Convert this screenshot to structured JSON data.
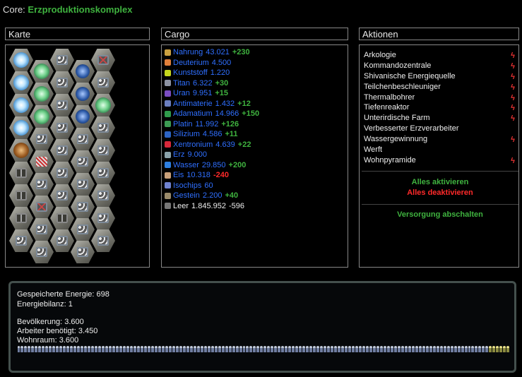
{
  "core": {
    "prefix": "Core:",
    "name": "Erzproduktionskomplex"
  },
  "panels": {
    "map": "Karte",
    "cargo": "Cargo",
    "actions": "Aktionen"
  },
  "cargo": [
    {
      "name": "Nahrung",
      "amount": "43.021",
      "delta": "+230",
      "sign": "pos",
      "color": "#caa040"
    },
    {
      "name": "Deuterium",
      "amount": "4.500",
      "delta": "",
      "sign": "",
      "color": "#e07f3a"
    },
    {
      "name": "Kunststoff",
      "amount": "1.220",
      "delta": "",
      "sign": "",
      "color": "#c6d81d"
    },
    {
      "name": "Titan",
      "amount": "6.322",
      "delta": "+30",
      "sign": "pos",
      "color": "#8d93a3"
    },
    {
      "name": "Uran",
      "amount": "9.951",
      "delta": "+15",
      "sign": "pos",
      "color": "#7a4cc2"
    },
    {
      "name": "Antimaterie",
      "amount": "1.432",
      "delta": "+12",
      "sign": "pos",
      "color": "#6b7fc0"
    },
    {
      "name": "Adamatium",
      "amount": "14.966",
      "delta": "+150",
      "sign": "pos",
      "color": "#2f9b4b"
    },
    {
      "name": "Platin",
      "amount": "11.992",
      "delta": "+126",
      "sign": "pos",
      "color": "#3c9b53"
    },
    {
      "name": "Silizium",
      "amount": "4.586",
      "delta": "+11",
      "sign": "pos",
      "color": "#2c64c4"
    },
    {
      "name": "Xentronium",
      "amount": "4.639",
      "delta": "+22",
      "sign": "pos",
      "color": "#d8283a"
    },
    {
      "name": "Erz",
      "amount": "9.000",
      "delta": "",
      "sign": "",
      "color": "#8aa2aa"
    },
    {
      "name": "Wasser",
      "amount": "29.850",
      "delta": "+200",
      "sign": "pos",
      "color": "#2e7fe0"
    },
    {
      "name": "Eis",
      "amount": "10.318",
      "delta": "-240",
      "sign": "neg",
      "color": "#c9a07a"
    },
    {
      "name": "Isochips",
      "amount": "60",
      "delta": "",
      "sign": "",
      "color": "#6f82d0"
    },
    {
      "name": "Gestein",
      "amount": "2.200",
      "delta": "+40",
      "sign": "pos",
      "color": "#9a8a6a"
    }
  ],
  "cargo_total": {
    "label": "Leer",
    "amount": "1.845.952",
    "delta": "-596"
  },
  "actions": [
    {
      "label": "Arkologie",
      "bolt": true
    },
    {
      "label": "Kommandozentrale",
      "bolt": true
    },
    {
      "label": "Shivanische Energiequelle",
      "bolt": true
    },
    {
      "label": "Teilchenbeschleuniger",
      "bolt": true
    },
    {
      "label": "Thermalbohrer",
      "bolt": true
    },
    {
      "label": "Tiefenreaktor",
      "bolt": true
    },
    {
      "label": "Unterirdische Farm",
      "bolt": true
    },
    {
      "label": "Verbesserter Erzverarbeiter",
      "bolt": false
    },
    {
      "label": "Wassergewinnung",
      "bolt": true
    },
    {
      "label": "Werft",
      "bolt": false
    },
    {
      "label": "Wohnpyramide",
      "bolt": true
    }
  ],
  "bolt_glyph": "ϟ",
  "action_links": {
    "activate_all": "Alles aktivieren",
    "deactivate_all": "Alles deaktivieren",
    "supply_off": "Versorgung abschalten"
  },
  "status": {
    "energy_stored": "Gespeicherte Energie: 698",
    "energy_balance": "Energiebilanz: 1",
    "population": "Bevölkerung: 3.600",
    "workers_needed": "Arbeiter benötigt: 3.450",
    "living_space": "Wohnraum: 3.600"
  },
  "colors": {
    "positive": "#3fb33f",
    "negative": "#ff2a2a",
    "amount": "#2f6fff",
    "core_name": "#3fb33f"
  }
}
